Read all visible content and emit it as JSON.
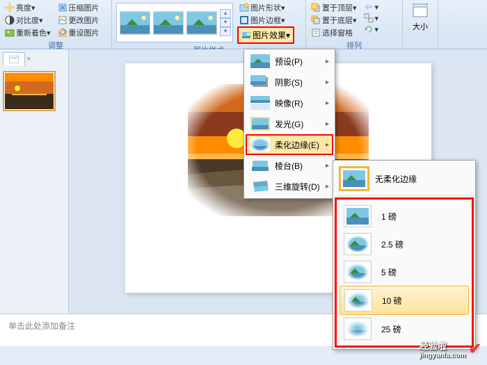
{
  "ribbon": {
    "adjust": {
      "brightness": "亮度",
      "contrast": "对比度",
      "recolor": "重新着色",
      "compress": "压缩图片",
      "change": "更改图片",
      "reset": "重设图片",
      "label": "调整"
    },
    "styles": {
      "shape": "图片形状",
      "border": "图片边框",
      "effects": "图片效果",
      "label": "图片样式"
    },
    "arrange": {
      "front": "置于顶层",
      "back": "置于底层",
      "pane": "选择窗格",
      "label": "排列"
    },
    "size": {
      "label": "大小"
    }
  },
  "effects_menu": {
    "preset": "预设(P)",
    "shadow": "阴影(S)",
    "reflection": "映像(R)",
    "glow": "发光(G)",
    "soft_edges": "柔化边缘(E)",
    "bevel": "棱台(B)",
    "rotation3d": "三维旋转(D)"
  },
  "soft_edges_menu": {
    "none": "无柔化边缘",
    "options": [
      "1 磅",
      "2.5 磅",
      "5 磅",
      "10 磅",
      "25 磅"
    ]
  },
  "notes": "单击此处添加备注",
  "watermark": {
    "brand": "经验啦",
    "url": "jingyanla.com"
  }
}
